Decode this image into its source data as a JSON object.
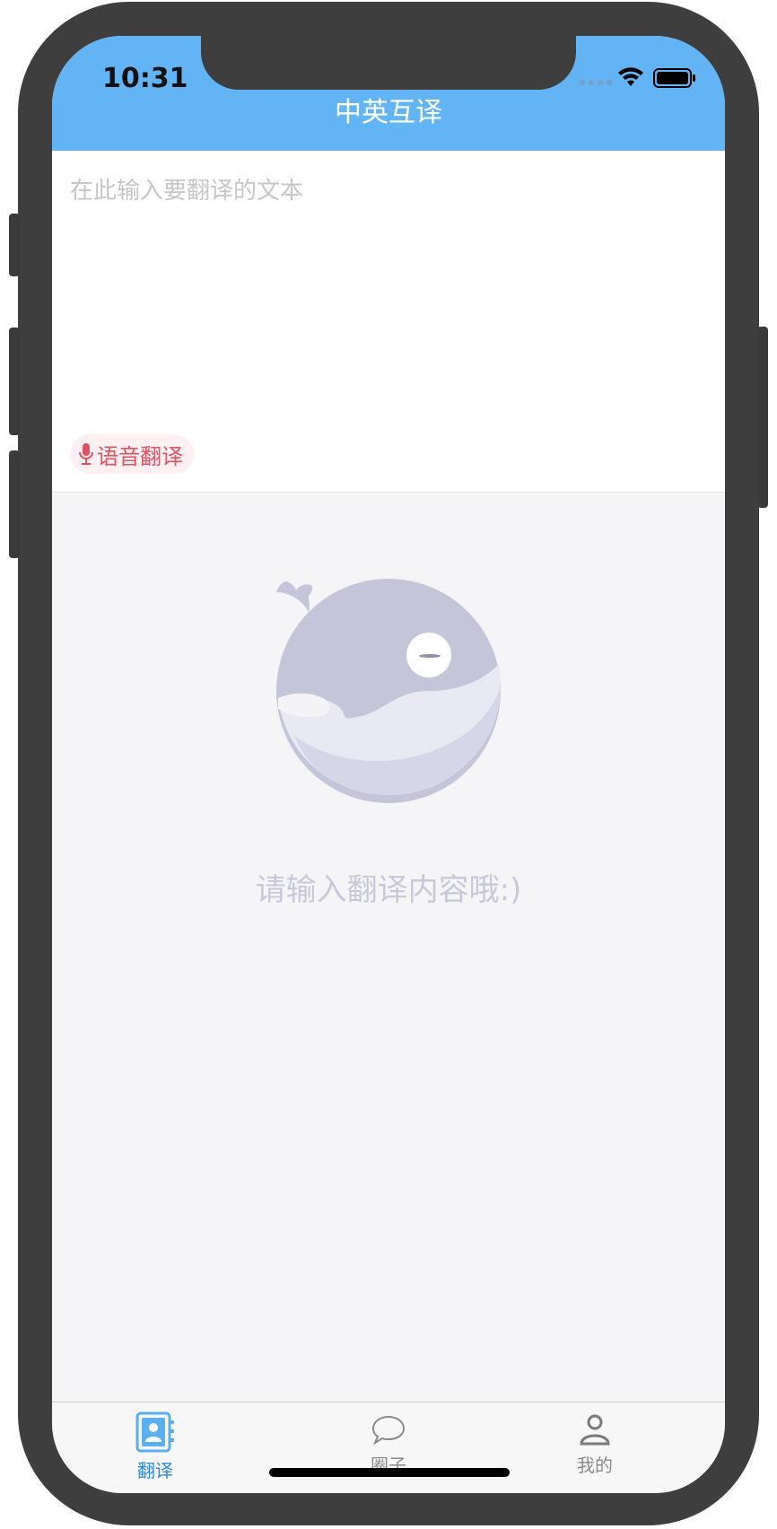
{
  "status_bar": {
    "time": "10:31",
    "icons": [
      "signal-icon",
      "wifi-icon",
      "battery-icon"
    ]
  },
  "header": {
    "title": "中英互译",
    "color": "#62b4f5"
  },
  "input": {
    "placeholder": "在此输入要翻译的文本",
    "value": ""
  },
  "voice_button": {
    "label": "语音翻译",
    "icon": "microphone-icon",
    "color": "#e05261"
  },
  "empty_state": {
    "message": "请输入翻译内容哦:)",
    "illustration": "whale-illustration"
  },
  "tabs": [
    {
      "label": "翻译",
      "icon": "contacts-book-icon",
      "active": true
    },
    {
      "label": "圈子",
      "icon": "chat-bubble-icon",
      "active": false
    },
    {
      "label": "我的",
      "icon": "person-icon",
      "active": false
    }
  ]
}
